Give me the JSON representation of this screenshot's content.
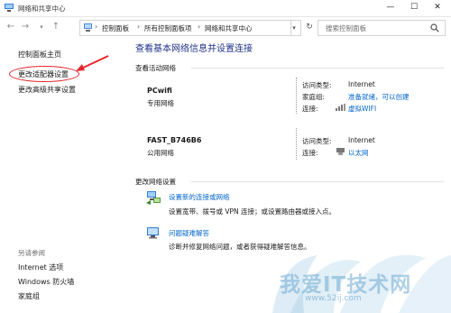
{
  "window": {
    "title": "网络和共享中心",
    "min_glyph": "—",
    "max_glyph": "☐",
    "close_glyph": "✕"
  },
  "address_bar": {
    "back_glyph": "←",
    "forward_glyph": "→",
    "up_glyph": "↑",
    "dropdown_glyph": "▾",
    "refresh_glyph": "↻",
    "sep_glyph": "›",
    "breadcrumbs": [
      "控制面板",
      "所有控制面板项",
      "网络和共享中心"
    ],
    "search_placeholder": "搜索控制面板"
  },
  "left_pane": {
    "links": [
      "控制面板主页",
      "更改适配器设置",
      "更改高级共享设置"
    ],
    "see_also_label": "另请参阅",
    "see_also_links": [
      "Internet 选项",
      "Windows 防火墙",
      "家庭组"
    ]
  },
  "main": {
    "title": "查看基本网络信息并设置连接",
    "active_networks_heading": "查看活动网络",
    "networks": [
      {
        "name": "PCwifi",
        "type": "专用网络",
        "access_type_label": "访问类型:",
        "access_type": "Internet",
        "homegroup_label": "家庭组:",
        "homegroup_value": "准备就绪，可以创建",
        "connection_label": "连接:",
        "connection": "虚拟WIFI"
      },
      {
        "name": "FAST_B746B6",
        "type": "公用网络",
        "access_type_label": "访问类型:",
        "access_type": "Internet",
        "connection_label": "连接:",
        "connection": "以太网"
      }
    ],
    "change_settings_heading": "更改网络设置",
    "tasks": [
      {
        "link": "设置新的连接或网络",
        "desc": "设置宽带、拨号或 VPN 连接；或设置路由器或接入点。"
      },
      {
        "link": "问题疑难解答",
        "desc": "诊断并修复网络问题，或者获得疑难解答信息。"
      }
    ]
  },
  "watermark": {
    "text": "我爱IT技术网",
    "url": "www.52ij.com"
  },
  "colors": {
    "link": "#0066cc",
    "title": "#1e3287",
    "annotation": "#e8262d"
  }
}
